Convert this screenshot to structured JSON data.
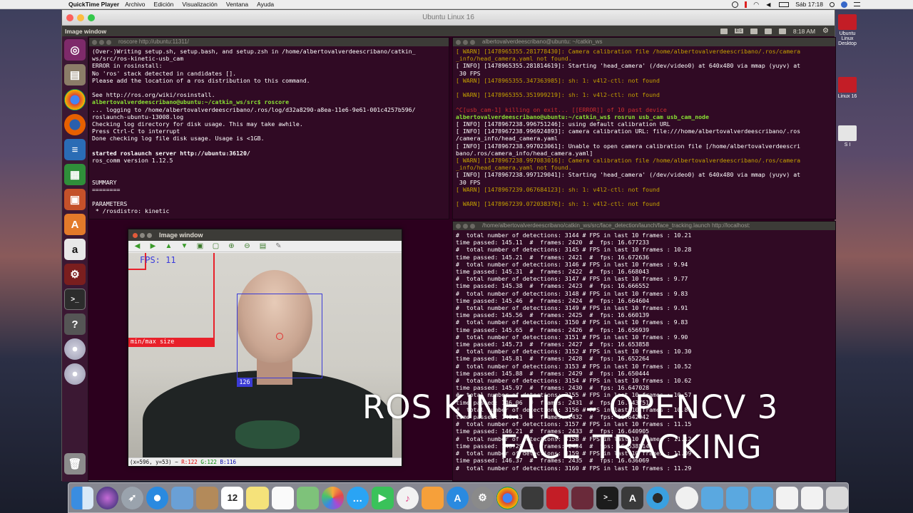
{
  "menubar": {
    "app_name": "QuickTime Player",
    "items": [
      "Archivo",
      "Edición",
      "Visualización",
      "Ventana",
      "Ayuda"
    ],
    "clock": "Sáb 17:18"
  },
  "vm": {
    "title": "Ubuntu Linux 16"
  },
  "ubuntu_panel": {
    "active_window": "Image window",
    "layout": "Es",
    "time": "8:18 AM"
  },
  "desktop_items": [
    {
      "label": "Ubuntu Linux Desktop"
    },
    {
      "label": "Linux 16"
    },
    {
      "label": "S I"
    }
  ],
  "term_roscore": {
    "title": "roscore http://ubuntu:11311/",
    "lines": [
      {
        "t": "(Over-)Writing setup.sh, setup.bash, and setup.zsh in /home/albertovalverdeescribano/catkin_",
        "c": ""
      },
      {
        "t": "ws/src/ros-kinetic-usb_cam",
        "c": ""
      },
      {
        "t": "ERROR in rosinstall:",
        "c": ""
      },
      {
        "t": "No 'ros' stack detected in candidates [].",
        "c": ""
      },
      {
        "t": "Please add the location of a ros distribution to this command.",
        "c": ""
      },
      {
        "t": "",
        "c": ""
      },
      {
        "t": "See http://ros.org/wiki/rosinstall.",
        "c": ""
      },
      {
        "t": "albertovalverdeescribano@ubuntu:~/catkin_ws/src$ roscore",
        "c": "prompt"
      },
      {
        "t": "... logging to /home/albertovalverdeescribano/.ros/log/d32a8290-a8ea-11e6-9e61-001c4257b596/",
        "c": ""
      },
      {
        "t": "roslaunch-ubuntu-13008.log",
        "c": ""
      },
      {
        "t": "Checking log directory for disk usage. This may take awhile.",
        "c": ""
      },
      {
        "t": "Press Ctrl-C to interrupt",
        "c": ""
      },
      {
        "t": "Done checking log file disk usage. Usage is <1GB.",
        "c": ""
      },
      {
        "t": "",
        "c": ""
      },
      {
        "t": "started roslaunch server http://ubuntu:36120/",
        "c": "bold"
      },
      {
        "t": "ros_comm version 1.12.5",
        "c": ""
      },
      {
        "t": "",
        "c": ""
      },
      {
        "t": "",
        "c": ""
      },
      {
        "t": "SUMMARY",
        "c": ""
      },
      {
        "t": "========",
        "c": ""
      },
      {
        "t": "",
        "c": ""
      },
      {
        "t": "PARAMETERS",
        "c": ""
      },
      {
        "t": " * /rosdistro: kinetic",
        "c": ""
      }
    ]
  },
  "term_usbcam": {
    "title": "albertovalverdeescribano@ubuntu: ~/catkin_ws",
    "lines": [
      {
        "t": "[ WARN] [1478965355.281778430]: Camera calibration file /home/albertovalverdeescribano/.ros/camera",
        "c": "warn"
      },
      {
        "t": "_info/head_camera.yaml not found.",
        "c": "warn"
      },
      {
        "t": "[ INFO] [1478965355.281814619]: Starting 'head_camera' (/dev/video0) at 640x480 via mmap (yuyv) at",
        "c": ""
      },
      {
        "t": " 30 FPS",
        "c": ""
      },
      {
        "t": "[ WARN] [1478965355.347363985]: sh: 1: v4l2-ctl: not found",
        "c": "warn"
      },
      {
        "t": "",
        "c": ""
      },
      {
        "t": "[ WARN] [1478965355.351999219]: sh: 1: v4l2-ctl: not found",
        "c": "warn"
      },
      {
        "t": "",
        "c": ""
      },
      {
        "t": "^C[usb_cam-1] killing on exit... [[ERROR]] of 10 past device",
        "c": "red"
      },
      {
        "t": "albertovalverdeescribano@ubuntu:~/catkin_ws$ rosrun usb_cam usb_cam_node",
        "c": "prompt2"
      },
      {
        "t": "[ INFO] [1478967238.996751246]: using default calibration URL",
        "c": ""
      },
      {
        "t": "[ INFO] [1478967238.996924893]: camera calibration URL: file:///home/albertovalverdeescribano/.ros",
        "c": ""
      },
      {
        "t": "/camera_info/head_camera.yaml",
        "c": ""
      },
      {
        "t": "[ INFO] [1478967238.997023061]: Unable to open camera calibration file [/home/albertovalverdeescri",
        "c": ""
      },
      {
        "t": "bano/.ros/camera_info/head_camera.yaml]",
        "c": ""
      },
      {
        "t": "[ WARN] [1478967238.997083016]: Camera calibration file /home/albertovalverdeescribano/.ros/camera",
        "c": "warn"
      },
      {
        "t": "_info/head_camera.yaml not found.",
        "c": "warn"
      },
      {
        "t": "[ INFO] [1478967238.997129041]: Starting 'head_camera' (/dev/video0) at 640x480 via mmap (yuyv) at",
        "c": ""
      },
      {
        "t": " 30 FPS",
        "c": ""
      },
      {
        "t": "[ WARN] [1478967239.067684123]: sh: 1: v4l2-ctl: not found",
        "c": "warn"
      },
      {
        "t": "",
        "c": ""
      },
      {
        "t": "[ WARN] [1478967239.072038376]: sh: 1: v4l2-ctl: not found",
        "c": "warn"
      }
    ]
  },
  "term_face": {
    "title": "/home/albertovalverdeescribano/catkin_ws/src/face_detection/launch/face_tracking.launch http://localhost:",
    "lines": [
      {
        "t": "#  total number of detections: 3144 # FPS in last 10 frames : 10.21",
        "c": ""
      },
      {
        "t": "time passed: 145.11  #  frames: 2420  #  fps: 16.677233",
        "c": ""
      },
      {
        "t": "#  total number of detections: 3145 # FPS in last 10 frames : 10.28",
        "c": ""
      },
      {
        "t": "time passed: 145.21  #  frames: 2421  #  fps: 16.672636",
        "c": ""
      },
      {
        "t": "#  total number of detections: 3146 # FPS in last 10 frames : 9.94",
        "c": ""
      },
      {
        "t": "time passed: 145.31  #  frames: 2422  #  fps: 16.668043",
        "c": ""
      },
      {
        "t": "#  total number of detections: 3147 # FPS in last 10 frames : 9.77",
        "c": ""
      },
      {
        "t": "time passed: 145.38  #  frames: 2423  #  fps: 16.666552",
        "c": ""
      },
      {
        "t": "#  total number of detections: 3148 # FPS in last 10 frames : 9.83",
        "c": ""
      },
      {
        "t": "time passed: 145.46  #  frames: 2424  #  fps: 16.664604",
        "c": ""
      },
      {
        "t": "#  total number of detections: 3149 # FPS in last 10 frames : 9.91",
        "c": ""
      },
      {
        "t": "time passed: 145.56  #  frames: 2425  #  fps: 16.660139",
        "c": ""
      },
      {
        "t": "#  total number of detections: 3150 # FPS in last 10 frames : 9.83",
        "c": ""
      },
      {
        "t": "time passed: 145.65  #  frames: 2426  #  fps: 16.656939",
        "c": ""
      },
      {
        "t": "#  total number of detections: 3151 # FPS in last 10 frames : 9.90",
        "c": ""
      },
      {
        "t": "time passed: 145.73  #  frames: 2427  #  fps: 16.653858",
        "c": ""
      },
      {
        "t": "#  total number of detections: 3152 # FPS in last 10 frames : 10.30",
        "c": ""
      },
      {
        "t": "time passed: 145.81  #  frames: 2428  #  fps: 16.652264",
        "c": ""
      },
      {
        "t": "#  total number of detections: 3153 # FPS in last 10 frames : 10.52",
        "c": ""
      },
      {
        "t": "time passed: 145.88  #  frames: 2429  #  fps: 16.650444",
        "c": ""
      },
      {
        "t": "#  total number of detections: 3154 # FPS in last 10 frames : 10.62",
        "c": ""
      },
      {
        "t": "time passed: 145.97  #  frames: 2430  #  fps: 16.647028",
        "c": ""
      },
      {
        "t": "#  total number of detections: 3155 # FPS in last 10 frames : 10.57",
        "c": ""
      },
      {
        "t": "time passed: 146.06  #  frames: 2431  #  fps: 16.643751",
        "c": ""
      },
      {
        "t": "#  total number of detections: 3156 # FPS in last 10 frames : 10.81",
        "c": ""
      },
      {
        "t": "time passed: 146.13  #  frames: 2432  #  fps: 16.642942",
        "c": ""
      },
      {
        "t": "#  total number of detections: 3157 # FPS in last 10 frames : 11.15",
        "c": ""
      },
      {
        "t": "time passed: 146.21  #  frames: 2433  #  fps: 16.640905",
        "c": ""
      },
      {
        "t": "#  total number of detections: 3158 # FPS in last 10 frames : 11.12",
        "c": ""
      },
      {
        "t": "time passed: 146.29  #  frames: 2434  #  fps: 16.638514",
        "c": ""
      },
      {
        "t": "#  total number of detections: 3159 # FPS in last 10 frames : 11.09",
        "c": ""
      },
      {
        "t": "time passed: 146.37  #  frames: 2435  #  fps: 16.636069",
        "c": ""
      },
      {
        "t": "#  total number of detections: 3160 # FPS in last 10 frames : 11.29",
        "c": ""
      }
    ]
  },
  "image_window": {
    "title": "Image window",
    "fps_label": "FPS: 11",
    "minmax_label": "min/max size",
    "face_id": "126",
    "status_prefix": "(x=596, y=53) ~ ",
    "status_r": "R:122",
    "status_g": "G:122",
    "status_b": "B:116"
  },
  "caption": {
    "line1": "ROS KINETIC - OPENCV 3",
    "line2": "FACE TRACKING"
  },
  "colors": {
    "terminal_bg": "#300a24",
    "warn": "#c4a000",
    "face_box": "#3b3bd6",
    "minmax_box": "#e8202a"
  }
}
